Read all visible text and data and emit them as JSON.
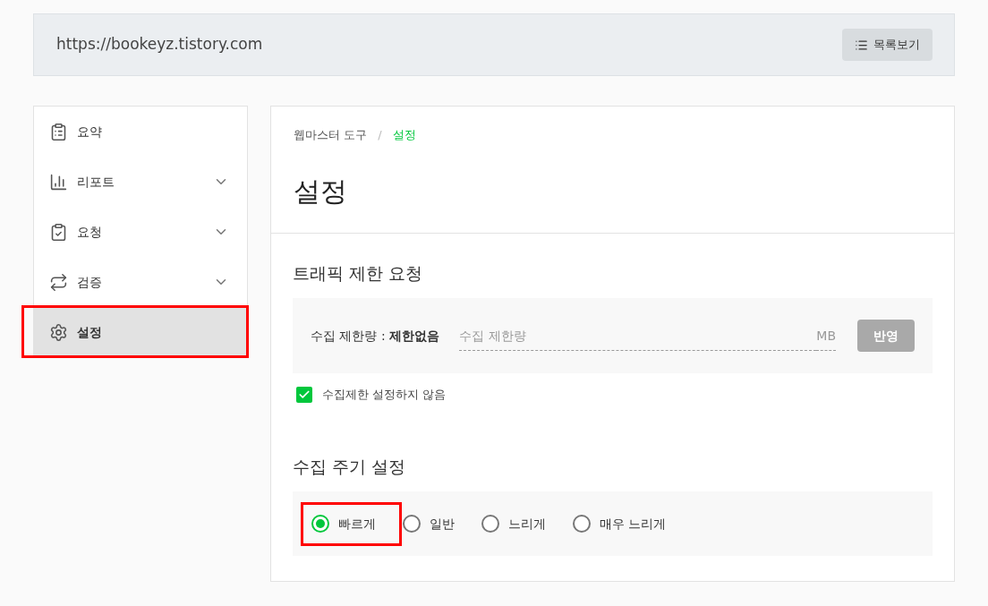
{
  "address_bar": {
    "url": "https://bookeyz.tistory.com",
    "list_button": "목록보기"
  },
  "sidebar": {
    "items": [
      {
        "kind": "summary",
        "label": "요약",
        "expandable": false,
        "selected": false,
        "highlighted": false
      },
      {
        "kind": "report",
        "label": "리포트",
        "expandable": true,
        "selected": false,
        "highlighted": false
      },
      {
        "kind": "request",
        "label": "요청",
        "expandable": true,
        "selected": false,
        "highlighted": false
      },
      {
        "kind": "verify",
        "label": "검증",
        "expandable": true,
        "selected": false,
        "highlighted": false
      },
      {
        "kind": "settings",
        "label": "설정",
        "expandable": false,
        "selected": true,
        "highlighted": true
      }
    ]
  },
  "breadcrumb": [
    "웹마스터 도구",
    "설정"
  ],
  "breadcrumb_separator": "/",
  "page_title": "설정",
  "traffic": {
    "heading": "트래픽 제한 요청",
    "limit_label": "수집 제한량 : **제한없음**",
    "placeholder": "수집 제한량",
    "unit": "MB",
    "apply_button": "반영",
    "apply_disabled": true,
    "no_limit": {
      "label": "수집제한 설정하지 않음",
      "checked": true
    }
  },
  "crawl": {
    "heading": "수집 주기 설정",
    "options": [
      {
        "label": "빠르게",
        "selected": true,
        "highlighted": true
      },
      {
        "label": "일반",
        "selected": false,
        "highlighted": false
      },
      {
        "label": "느리게",
        "selected": false,
        "highlighted": false
      },
      {
        "label": "매우 느리게",
        "selected": false,
        "highlighted": false
      }
    ]
  }
}
